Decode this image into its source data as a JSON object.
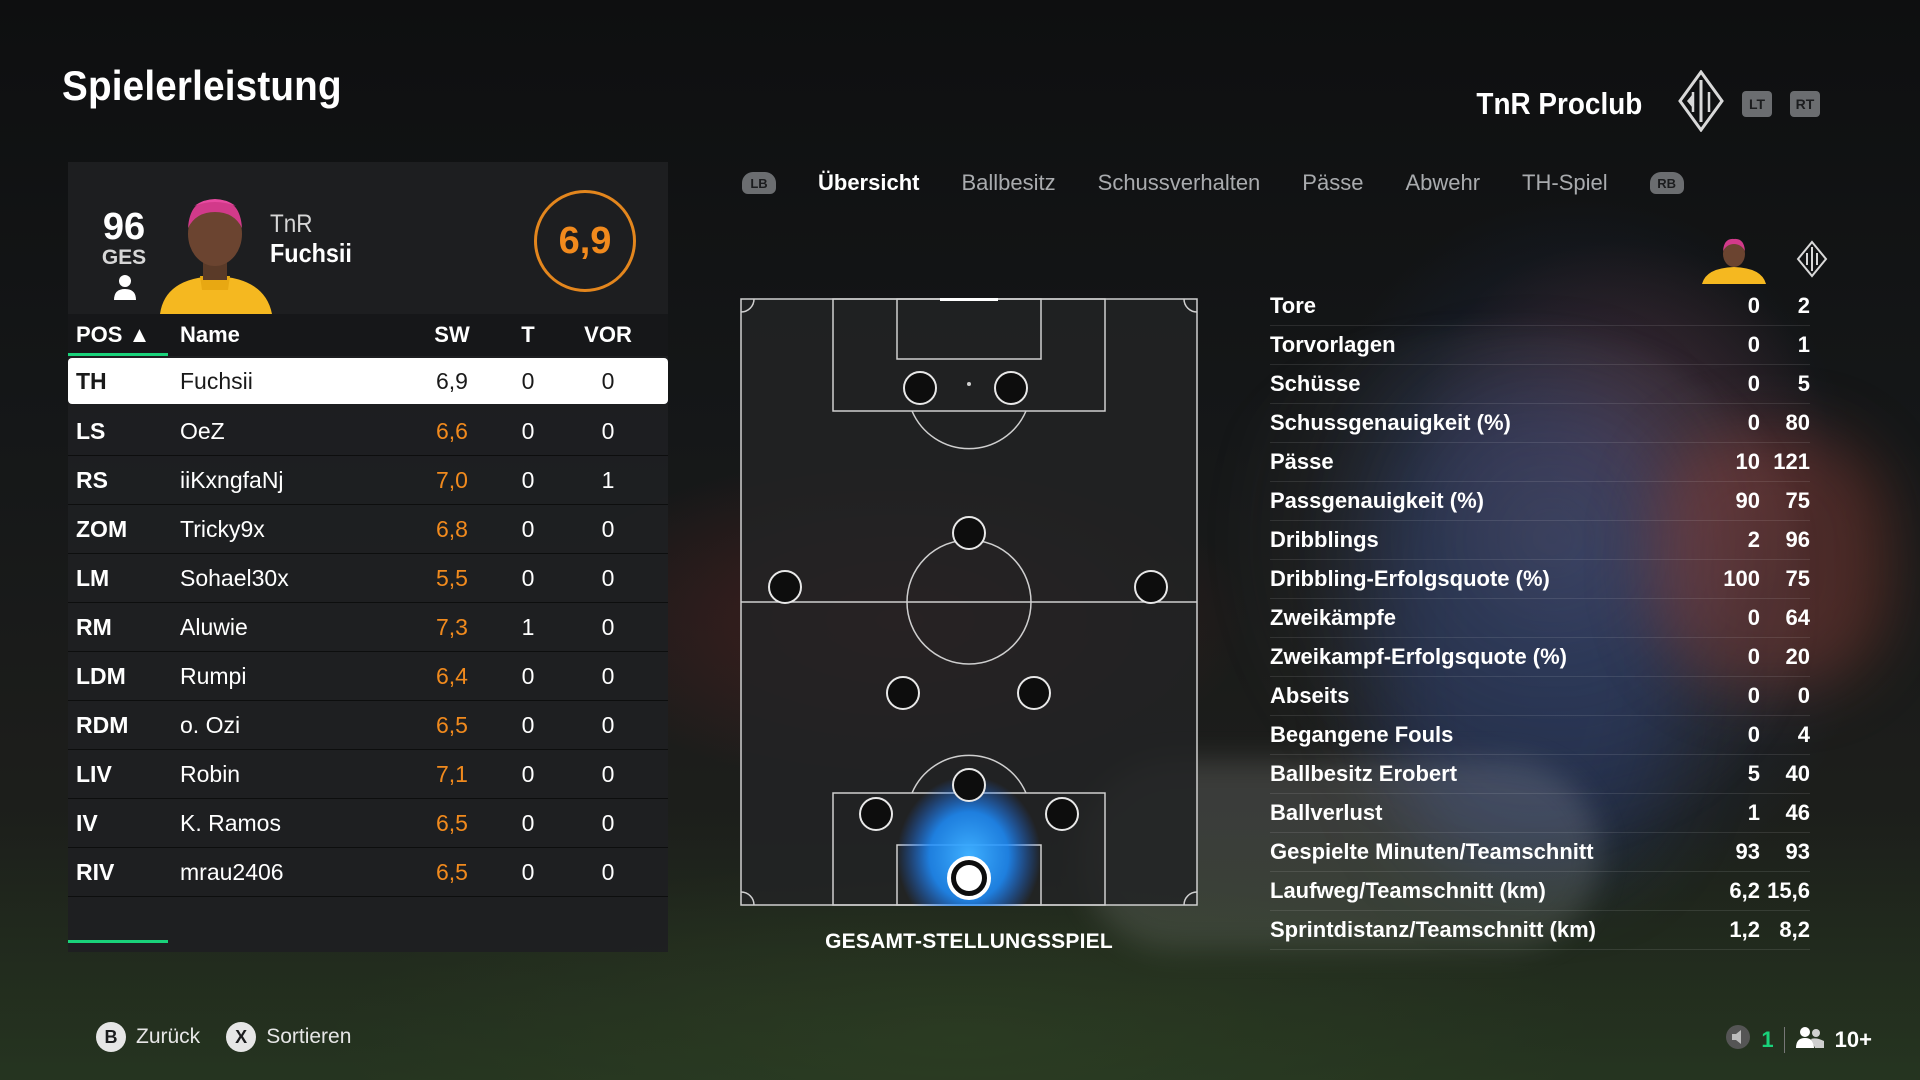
{
  "page": {
    "title": "Spielerleistung"
  },
  "club": {
    "name": "TnR Proclub",
    "lt": "LT",
    "rt": "RT"
  },
  "player_card": {
    "overall": "96",
    "overall_label": "GES",
    "team": "TnR",
    "name": "Fuchsii",
    "match_rating": "6,9"
  },
  "table": {
    "headers": {
      "pos": "POS ▲",
      "name": "Name",
      "sw": "SW",
      "t": "T",
      "vor": "VOR"
    },
    "rows": [
      {
        "pos": "TH",
        "name": "Fuchsii",
        "sw": "6,9",
        "t": "0",
        "vor": "0"
      },
      {
        "pos": "LS",
        "name": "OeZ",
        "sw": "6,6",
        "t": "0",
        "vor": "0"
      },
      {
        "pos": "RS",
        "name": "iiKxngfaNj",
        "sw": "7,0",
        "t": "0",
        "vor": "1"
      },
      {
        "pos": "ZOM",
        "name": "Tricky9x",
        "sw": "6,8",
        "t": "0",
        "vor": "0"
      },
      {
        "pos": "LM",
        "name": "Sohael30x",
        "sw": "5,5",
        "t": "0",
        "vor": "0"
      },
      {
        "pos": "RM",
        "name": "Aluwie",
        "sw": "7,3",
        "t": "1",
        "vor": "0"
      },
      {
        "pos": "LDM",
        "name": "Rumpi",
        "sw": "6,4",
        "t": "0",
        "vor": "0"
      },
      {
        "pos": "RDM",
        "name": "o. Ozi",
        "sw": "6,5",
        "t": "0",
        "vor": "0"
      },
      {
        "pos": "LIV",
        "name": "Robin",
        "sw": "7,1",
        "t": "0",
        "vor": "0"
      },
      {
        "pos": "IV",
        "name": "K. Ramos",
        "sw": "6,5",
        "t": "0",
        "vor": "0"
      },
      {
        "pos": "RIV",
        "name": "mrau2406",
        "sw": "6,5",
        "t": "0",
        "vor": "0"
      }
    ]
  },
  "tabs": {
    "lb": "LB",
    "rb": "RB",
    "items": [
      "Übersicht",
      "Ballbesitz",
      "Schussverhalten",
      "Pässe",
      "Abwehr",
      "TH-Spiel"
    ]
  },
  "pitch": {
    "caption": "GESAMT-STELLUNGSSPIEL"
  },
  "stats": [
    {
      "label": "Tore",
      "player": "0",
      "team": "2"
    },
    {
      "label": "Torvorlagen",
      "player": "0",
      "team": "1"
    },
    {
      "label": "Schüsse",
      "player": "0",
      "team": "5"
    },
    {
      "label": "Schussgenauigkeit (%)",
      "player": "0",
      "team": "80"
    },
    {
      "label": "Pässe",
      "player": "10",
      "team": "121"
    },
    {
      "label": "Passgenauigkeit (%)",
      "player": "90",
      "team": "75"
    },
    {
      "label": "Dribblings",
      "player": "2",
      "team": "96"
    },
    {
      "label": "Dribbling-Erfolgsquote (%)",
      "player": "100",
      "team": "75"
    },
    {
      "label": "Zweikämpfe",
      "player": "0",
      "team": "64"
    },
    {
      "label": "Zweikampf-Erfolgsquote (%)",
      "player": "0",
      "team": "20"
    },
    {
      "label": "Abseits",
      "player": "0",
      "team": "0"
    },
    {
      "label": "Begangene Fouls",
      "player": "0",
      "team": "4"
    },
    {
      "label": "Ballbesitz Erobert",
      "player": "5",
      "team": "40"
    },
    {
      "label": "Ballverlust",
      "player": "1",
      "team": "46"
    },
    {
      "label": "Gespielte Minuten/Teamschnitt",
      "player": "93",
      "team": "93"
    },
    {
      "label": "Laufweg/Teamschnitt (km)",
      "player": "6,2",
      "team": "15,6"
    },
    {
      "label": "Sprintdistanz/Teamschnitt (km)",
      "player": "1,2",
      "team": "8,2"
    }
  ],
  "footer": {
    "back_button": "B",
    "back_label": "Zurück",
    "sort_button": "X",
    "sort_label": "Sortieren",
    "online_count": "1",
    "party_count": "10+"
  },
  "colors": {
    "accent_orange": "#f18a1d",
    "accent_green": "#19d27a",
    "heatmap_blue": "#1e8fff"
  },
  "icons": [
    "person-icon",
    "club-crest-icon",
    "speaker-icon",
    "party-icon"
  ]
}
